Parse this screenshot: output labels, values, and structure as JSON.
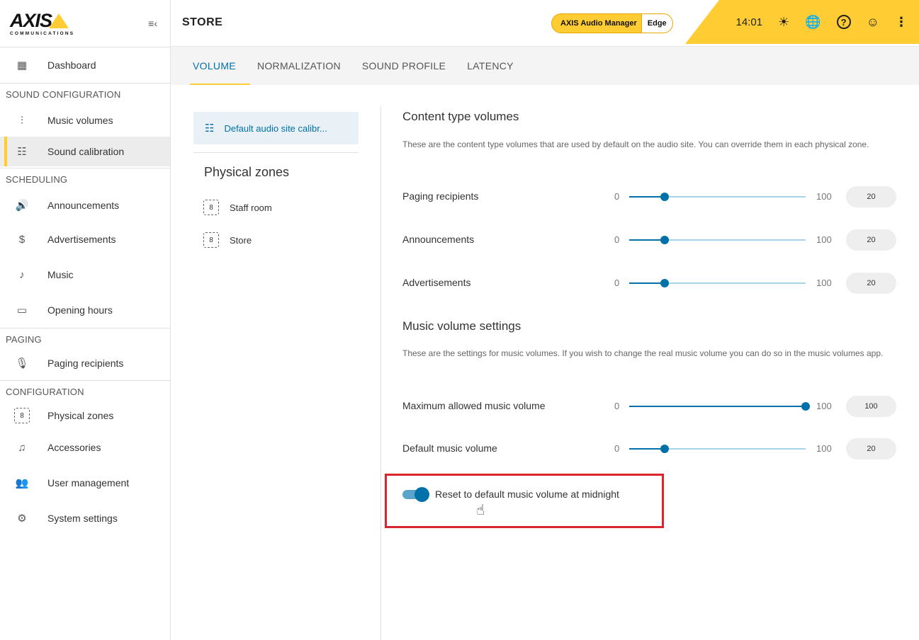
{
  "app": {
    "logo_text": "AXIS",
    "logo_sub": "COMMUNICATIONS",
    "page_title": "STORE",
    "product_name": "AXIS Audio Manager",
    "product_edition": "Edge",
    "clock": "14:01"
  },
  "icons": {
    "collapse": "≡‹",
    "sun": "☀",
    "globe": "🌐",
    "help": "?",
    "user": "☺",
    "more": "⋮",
    "dashboard": "▦",
    "music_volumes": "⫶",
    "sound_calibration": "☷",
    "announcements": "🔊",
    "advertisements": "$",
    "music": "♪",
    "opening_hours": "▭",
    "paging_recipients": "🎙",
    "physical_zones": "8",
    "accessories": "♫",
    "user_management": "👥",
    "system_settings": "⚙",
    "site_calibration": "☷",
    "zone": "8",
    "hand_cursor": "☝"
  },
  "sidebar": {
    "dashboard": "Dashboard",
    "groups": {
      "sound_configuration": "SOUND CONFIGURATION",
      "scheduling": "SCHEDULING",
      "paging": "PAGING",
      "configuration": "CONFIGURATION"
    },
    "items": {
      "music_volumes": "Music volumes",
      "sound_calibration": "Sound calibration",
      "announcements": "Announcements",
      "advertisements": "Advertisements",
      "music": "Music",
      "opening_hours": "Opening hours",
      "paging_recipients": "Paging recipients",
      "physical_zones": "Physical zones",
      "accessories": "Accessories",
      "user_management": "User management",
      "system_settings": "System settings"
    },
    "active_item": "Sound calibration"
  },
  "tabs": [
    "VOLUME",
    "NORMALIZATION",
    "SOUND PROFILE",
    "LATENCY"
  ],
  "active_tab": "VOLUME",
  "left_panel": {
    "site_item": "Default audio site calibr...",
    "physical_zones_title": "Physical zones",
    "zones": [
      "Staff room",
      "Store"
    ]
  },
  "content_volumes": {
    "title": "Content type volumes",
    "description": "These are the content type volumes that are used by default on the audio site. You can override them in each physical zone.",
    "rows": [
      {
        "label": "Paging recipients",
        "min": "0",
        "max": "100",
        "value": "20",
        "level": 20
      },
      {
        "label": "Announcements",
        "min": "0",
        "max": "100",
        "value": "20",
        "level": 20
      },
      {
        "label": "Advertisements",
        "min": "0",
        "max": "100",
        "value": "20",
        "level": 20
      }
    ]
  },
  "music_settings": {
    "title": "Music volume settings",
    "description": "These are the settings for music volumes. If you wish to change the real music volume you can do so in the music volumes app.",
    "rows": [
      {
        "label": "Maximum allowed music volume",
        "min": "0",
        "max": "100",
        "value": "100",
        "level": 100
      },
      {
        "label": "Default music volume",
        "min": "0",
        "max": "100",
        "value": "20",
        "level": 20
      }
    ],
    "reset_toggle": {
      "label": "Reset to default music volume at midnight",
      "enabled": true
    }
  },
  "colors": {
    "accent_yellow": "#ffcc33",
    "primary_blue": "#0070a8",
    "highlight_red": "#d9262e"
  }
}
